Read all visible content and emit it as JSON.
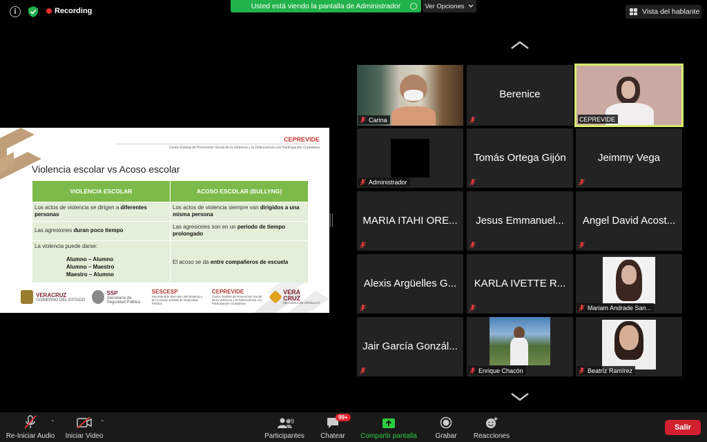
{
  "topbar": {
    "recording": "Recording",
    "share_banner": "Usted está viendo la pantalla de Administrador",
    "view_options": "Ver Opciones",
    "speaker_view": "Vista del hablante"
  },
  "slide": {
    "brand": "CEPREVIDE",
    "subtitle": "Centro Estatal de Prevención Social de la Violencia y la Delincuencia con Participación Ciudadana",
    "title": "Violencia escolar vs Acoso escolar",
    "col1_header": "VIOLENCIA ESCOLAR",
    "col2_header": "ACOSO ESCOLAR (BULLYNG)",
    "row1_left_a": "Los actos de violencia se dirigen a ",
    "row1_left_b": "diferentes personas",
    "row1_right_a": "Los actos de violencia siempre van ",
    "row1_right_b": "dirigidos a una misma persona",
    "row2_left_a": "Las agresiones ",
    "row2_left_b": "duran poco tiempo",
    "row2_right_a": "Las agresiones son en un ",
    "row2_right_b": "periodo de tiempo prolongado",
    "row3_left_intro": "La violencia puede darse:",
    "row3_left_1": "Alumno – Alumno",
    "row3_left_2": "Alumno – Maestro",
    "row3_left_3": "Maestro – Alumno",
    "row3_right_a": "El acoso se da ",
    "row3_right_b": "entre compañeros de escuela",
    "logos": {
      "veracruz_a": "VERACRUZ",
      "veracruz_b": "GOBIERNO DEL ESTADO",
      "ssp_a": "SSP",
      "ssp_b": "Secretaría de Seguridad Pública",
      "sescesp_a": "SESCESP",
      "sescesp_b": "Secretariado Ejecutivo del Sistema y del Consejo Estatal de Seguridad Pública",
      "ceprevide_a": "CEPREVIDE",
      "ceprevide_b": "Centro Estatal de Prevención Social de la Violencia y la Delincuencia con Participación Ciudadana",
      "vera_a": "VERA",
      "vera_b": "CRUZ",
      "vera_c": "ME LLENA DE ORGULLO"
    }
  },
  "participants": [
    {
      "label": "Carina"
    },
    {
      "big": "Berenice"
    },
    {
      "label": "CEPREVIDE"
    },
    {
      "label": "Administrador"
    },
    {
      "big": "Tomás Ortega Gijón"
    },
    {
      "big": "Jeimmy Vega"
    },
    {
      "big": "MARIA ITAHI ORE..."
    },
    {
      "big": "Jesus Emmanuel..."
    },
    {
      "big": "Angel David Acost..."
    },
    {
      "big": "Alexis Argüelles G..."
    },
    {
      "big": "KARLA IVETTE R..."
    },
    {
      "label": "Mariam Andrade San..."
    },
    {
      "big": "Jair García Gonzál..."
    },
    {
      "label": "Enrique Chacón"
    },
    {
      "label": "Beatríz Ramírez"
    }
  ],
  "toolbar": {
    "audio": "Re-Iniciar Audio",
    "video": "Iniciar Video",
    "participants": "Participantes",
    "participants_count": "99",
    "chat": "Chatear",
    "chat_badge": "99+",
    "share": "Compartir pantalla",
    "record": "Grabar",
    "reactions": "Reacciones",
    "leave": "Salir"
  },
  "colors": {
    "share_banner": "#22b24c",
    "active_speaker": "#d6e96b",
    "table_header": "#7cba4a",
    "leave": "#d1202f"
  }
}
